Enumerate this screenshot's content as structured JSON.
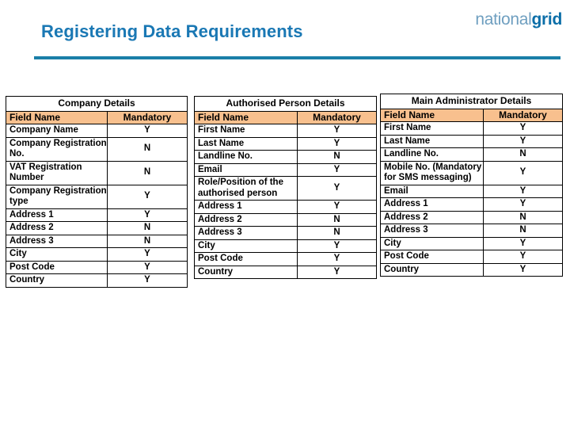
{
  "header": {
    "title": "Registering Data Requirements",
    "brand_light": "national",
    "brand_bold": "grid",
    "accent_color": "#1a7fa8",
    "title_color": "#1a78b4"
  },
  "tables": [
    {
      "id": "company-details",
      "title": "Company Details",
      "columns": [
        "Field Name",
        "Mandatory"
      ],
      "header_fill": "#f8c08e",
      "rows": [
        {
          "field": "Company Name",
          "mandatory": "Y"
        },
        {
          "field": "Company Registration No.",
          "mandatory": "N"
        },
        {
          "field": "VAT Registration Number",
          "mandatory": "N"
        },
        {
          "field": "Company Registration type",
          "mandatory": "Y"
        },
        {
          "field": "Address 1",
          "mandatory": "Y"
        },
        {
          "field": "Address 2",
          "mandatory": "N"
        },
        {
          "field": "Address 3",
          "mandatory": "N"
        },
        {
          "field": "City",
          "mandatory": "Y"
        },
        {
          "field": "Post Code",
          "mandatory": "Y"
        },
        {
          "field": "Country",
          "mandatory": "Y"
        }
      ]
    },
    {
      "id": "authorised-person",
      "title": "Authorised Person Details",
      "columns": [
        "Field Name",
        "Mandatory"
      ],
      "header_fill": "#f8c08e",
      "rows": [
        {
          "field": "First Name",
          "mandatory": "Y"
        },
        {
          "field": "Last Name",
          "mandatory": "Y"
        },
        {
          "field": "Landline No.",
          "mandatory": "N"
        },
        {
          "field": "Email",
          "mandatory": "Y"
        },
        {
          "field": "Role/Position of the authorised person",
          "mandatory": "Y"
        },
        {
          "field": "Address 1",
          "mandatory": "Y"
        },
        {
          "field": "Address 2",
          "mandatory": "N"
        },
        {
          "field": "Address 3",
          "mandatory": "N"
        },
        {
          "field": "City",
          "mandatory": "Y"
        },
        {
          "field": "Post Code",
          "mandatory": "Y"
        },
        {
          "field": "Country",
          "mandatory": "Y"
        }
      ]
    },
    {
      "id": "main-admin",
      "title": "Main Administrator Details",
      "columns": [
        "Field Name",
        "Mandatory"
      ],
      "header_fill": "#f8c08e",
      "rows": [
        {
          "field": "First Name",
          "mandatory": "Y"
        },
        {
          "field": "Last Name",
          "mandatory": "Y"
        },
        {
          "field": "Landline No.",
          "mandatory": "N"
        },
        {
          "field": "Mobile No. (Mandatory for SMS messaging)",
          "mandatory": "Y"
        },
        {
          "field": "Email",
          "mandatory": "Y"
        },
        {
          "field": "Address 1",
          "mandatory": "Y"
        },
        {
          "field": "Address 2",
          "mandatory": "N"
        },
        {
          "field": "Address 3",
          "mandatory": "N"
        },
        {
          "field": "City",
          "mandatory": "Y"
        },
        {
          "field": "Post Code",
          "mandatory": "Y"
        },
        {
          "field": "Country",
          "mandatory": "Y"
        }
      ]
    }
  ]
}
